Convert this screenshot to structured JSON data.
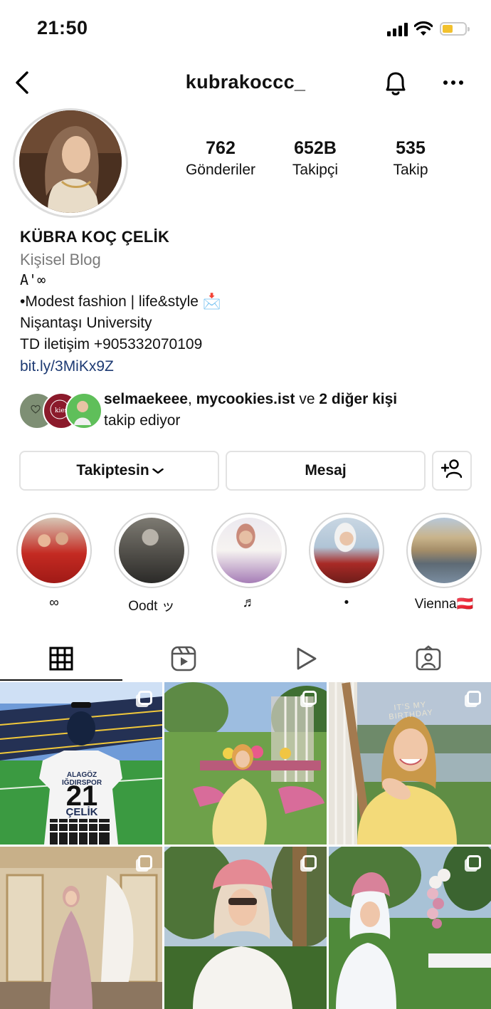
{
  "status_bar": {
    "time": "21:50"
  },
  "header": {
    "username": "kubrakoccc_"
  },
  "stats": [
    {
      "value": "762",
      "label": "Gönderiler"
    },
    {
      "value": "652B",
      "label": "Takipçi"
    },
    {
      "value": "535",
      "label": "Takip"
    }
  ],
  "profile": {
    "name": "KÜBRA KOÇ ÇELİK",
    "category": "Kişisel Blog",
    "bio_lines": [
      "A'∞",
      "•Modest fashion | life&style 📩",
      "Nişantaşı University",
      "TD iletişim +905332070109"
    ],
    "link": "bit.ly/3MiKx9Z"
  },
  "followed_by": {
    "user1": "selmaekeee",
    "sep": ", ",
    "user2": "mycookies.ist",
    "connector": " ve ",
    "others": "2 diğer kişi",
    "suffix": "takip ediyor"
  },
  "actions": {
    "following_label": "Takiptesin",
    "message_label": "Mesaj"
  },
  "highlights": [
    {
      "caption": "∞"
    },
    {
      "caption": "Oodt ッ"
    },
    {
      "caption": "♬"
    },
    {
      "caption": "•"
    },
    {
      "caption": "Vienna🇦🇹"
    }
  ],
  "tabs": [
    "grid-icon",
    "reels-icon",
    "video-play-icon",
    "tagged-icon"
  ],
  "posts": [
    {
      "type": "carousel",
      "jersey_number": "21",
      "jersey_name": "ÇELİK",
      "jersey_team": "ALAGÖZ IĞDIRSPOR"
    },
    {
      "type": "carousel"
    },
    {
      "type": "carousel",
      "sign_text": "IT'S MY BIRTHDAY"
    },
    {
      "type": "carousel"
    },
    {
      "type": "carousel"
    },
    {
      "type": "carousel"
    }
  ],
  "colors": {
    "link": "#1d3a73",
    "battery": "#f2c12e",
    "border": "#e2e2e2"
  }
}
